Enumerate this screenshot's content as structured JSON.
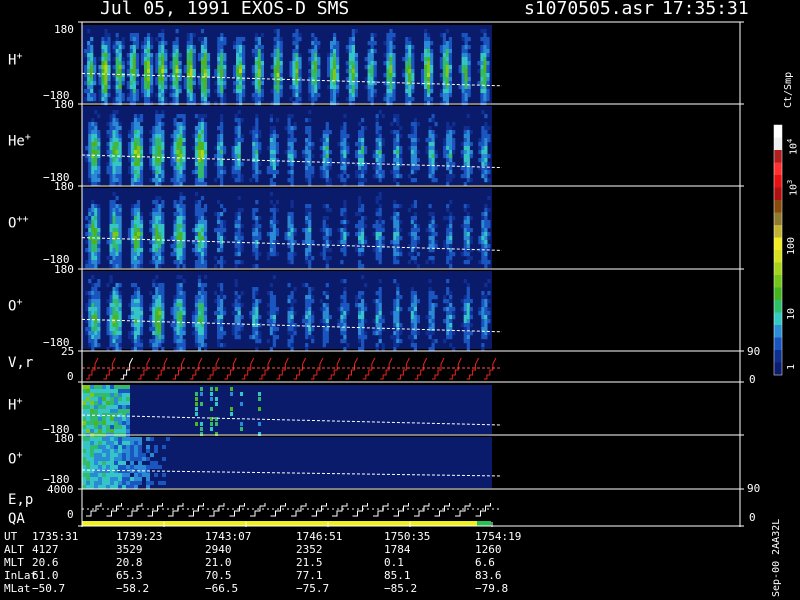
{
  "header": {
    "date_instrument": "Jul 05, 1991   EXOS-D SMS",
    "file": "s1070505.asr",
    "time": "17:35:31"
  },
  "panels": [
    {
      "label": "H",
      "sup": "+",
      "top_tick": "180",
      "bot_tick": "−180"
    },
    {
      "label": "He",
      "sup": "+",
      "top_tick": "180",
      "bot_tick": "−180"
    },
    {
      "label": "O",
      "sup": "++",
      "top_tick": "180",
      "bot_tick": "−180"
    },
    {
      "label": "O",
      "sup": "+",
      "top_tick": "180",
      "bot_tick": "−180"
    },
    {
      "label": "V,r",
      "sup": "",
      "top_tick": "25",
      "bot_tick": "0",
      "right_top": "90",
      "right_bot": "0"
    },
    {
      "label": "H",
      "sup": "+",
      "top_tick": "180",
      "bot_tick": "−180"
    },
    {
      "label": "O",
      "sup": "+",
      "top_tick": "180",
      "bot_tick": "−180"
    },
    {
      "label": "E,p",
      "sub_label": "QA",
      "top_tick": "4000",
      "bot_tick": "0",
      "right_top": "90",
      "right_bot": "0"
    }
  ],
  "colorbar": {
    "title": "Ct/Smp",
    "labels": [
      {
        "text": "1",
        "sup": ""
      },
      {
        "text": "10",
        "sup": ""
      },
      {
        "text": "100",
        "sup": ""
      },
      {
        "text": "10",
        "sup": "3"
      },
      {
        "text": "10",
        "sup": "4"
      }
    ],
    "colors": [
      "#0c1c6e",
      "#0d2f90",
      "#1a54bf",
      "#2a8fd6",
      "#35c9c4",
      "#2dbf6a",
      "#44b520",
      "#73c51b",
      "#a6d31c",
      "#d6e21f",
      "#f2ec22",
      "#c4b234",
      "#907a2d",
      "#8a4b0a",
      "#b01010",
      "#e81010",
      "#ff3030",
      "#b02020",
      "#f0f0f0",
      "#ffffff"
    ]
  },
  "footer": {
    "rows": [
      {
        "name": "UT",
        "values": [
          "1735:31",
          "1739:23",
          "1743:07",
          "1746:51",
          "1750:35",
          "1754:19"
        ]
      },
      {
        "name": "ALT",
        "values": [
          "4127",
          "3529",
          "2940",
          "2352",
          "1784",
          "1260"
        ]
      },
      {
        "name": "MLT",
        "values": [
          "20.6",
          "20.8",
          "21.0",
          "21.5",
          "0.1",
          "6.6"
        ]
      },
      {
        "name": "InLat",
        "values": [
          "61.0",
          "65.3",
          "70.5",
          "77.1",
          "85.1",
          "83.6"
        ]
      },
      {
        "name": "MLat",
        "values": [
          "−50.7",
          "−58.2",
          "−66.5",
          "−75.7",
          "−85.2",
          "−79.8"
        ]
      }
    ],
    "side_note": "Sep-00 2AA32L"
  },
  "chart_data": {
    "type": "heatmap",
    "title": "Jul 05, 1991   EXOS-D SMS",
    "x_ticks": [
      "1735:31",
      "1739:23",
      "1743:07",
      "1746:51",
      "1750:35",
      "1754:19"
    ],
    "data_end_fraction": 0.6,
    "colorbar_unit": "Ct/Smp",
    "colorbar_range": [
      1,
      10000
    ],
    "colorbar_scale": "log",
    "panels": [
      {
        "label": "H+",
        "y_range": [
          -180,
          180
        ],
        "sweeps": 24
      },
      {
        "label": "He+",
        "y_range": [
          -180,
          180
        ],
        "sweeps": 22
      },
      {
        "label": "O++",
        "y_range": [
          -180,
          180
        ],
        "sweeps": 22
      },
      {
        "label": "O+",
        "y_range": [
          -180,
          180
        ],
        "sweeps": 22
      },
      {
        "label": "V,r",
        "y_range": [
          0,
          25
        ],
        "right_range": [
          0,
          90
        ]
      },
      {
        "label": "H+",
        "y_range": [
          -180,
          180
        ]
      },
      {
        "label": "O+",
        "y_range": [
          -180,
          180
        ]
      },
      {
        "label": "E,p",
        "y_range": [
          0,
          4000
        ],
        "right_range": [
          0,
          90
        ]
      }
    ]
  }
}
